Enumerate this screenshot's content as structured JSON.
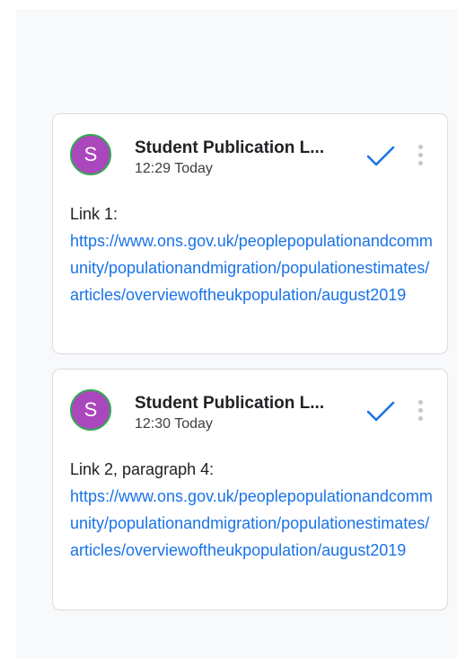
{
  "comments": [
    {
      "avatar_initial": "S",
      "author": "Student Publication L...",
      "time": "12:29 Today",
      "label": "Link 1:",
      "link": "https://www.ons.gov.uk/peoplepopulationandcommunity/populationandmigration/populationestimates/articles/overviewoftheukpopulation/august2019",
      "icons": {
        "resolve": "check-icon",
        "more": "more-vert-icon"
      }
    },
    {
      "avatar_initial": "S",
      "author": "Student Publication L...",
      "time": "12:30 Today",
      "label": "Link 2, paragraph 4:",
      "link": "https://www.ons.gov.uk/peoplepopulationandcommunity/populationandmigration/populationestimates/articles/overviewoftheukpopulation/august2019",
      "icons": {
        "resolve": "check-icon",
        "more": "more-vert-icon"
      }
    }
  ],
  "colors": {
    "avatar": "#ab47bc",
    "avatar_ring": "#34a853",
    "link": "#1a73e8",
    "check": "#1a73e8",
    "panel_bg": "#f8f9fa",
    "card_border": "#dadce0"
  }
}
